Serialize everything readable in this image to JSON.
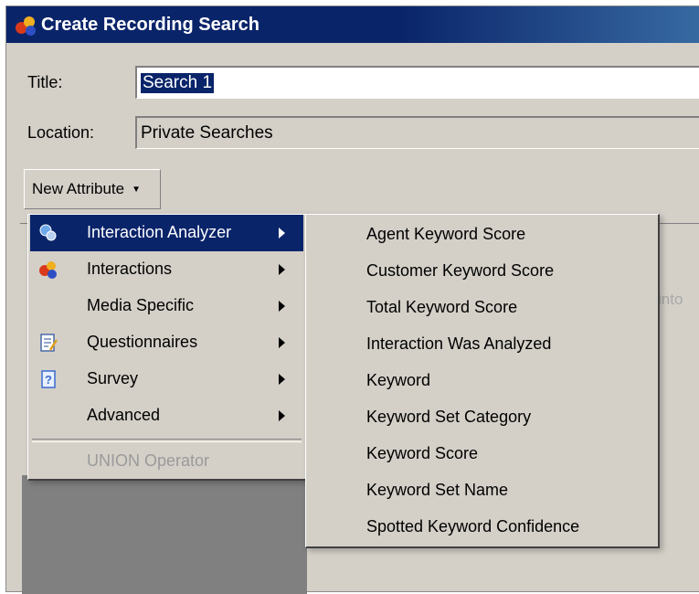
{
  "window": {
    "title": "Create Recording Search",
    "icon": "app-icon"
  },
  "form": {
    "title_label": "Title:",
    "title_value": "Search 1",
    "location_label": "Location:",
    "location_value": "Private Searches"
  },
  "new_attribute_button": {
    "label": "New Attribute",
    "icon": "chevron-down-icon"
  },
  "background_text": "into",
  "attribute_menu": {
    "items": [
      {
        "label": "Interaction Analyzer",
        "icon": "analyzer-icon",
        "highlighted": true
      },
      {
        "label": "Interactions",
        "icon": "interactions-icon"
      },
      {
        "label": "Media Specific",
        "icon": ""
      },
      {
        "label": "Questionnaires",
        "icon": "questionnaire-icon"
      },
      {
        "label": "Survey",
        "icon": "survey-icon"
      },
      {
        "label": "Advanced",
        "icon": ""
      }
    ],
    "union_operator": "UNION Operator"
  },
  "submenu": {
    "items": [
      "Agent Keyword Score",
      "Customer Keyword Score",
      "Total Keyword Score",
      "Interaction Was Analyzed",
      "Keyword",
      "Keyword Set Category",
      "Keyword Score",
      "Keyword Set Name",
      "Spotted Keyword Confidence"
    ]
  },
  "colors": {
    "titlebar": "#0a246a",
    "highlight": "#0a246a",
    "face": "#d4d0c8"
  }
}
